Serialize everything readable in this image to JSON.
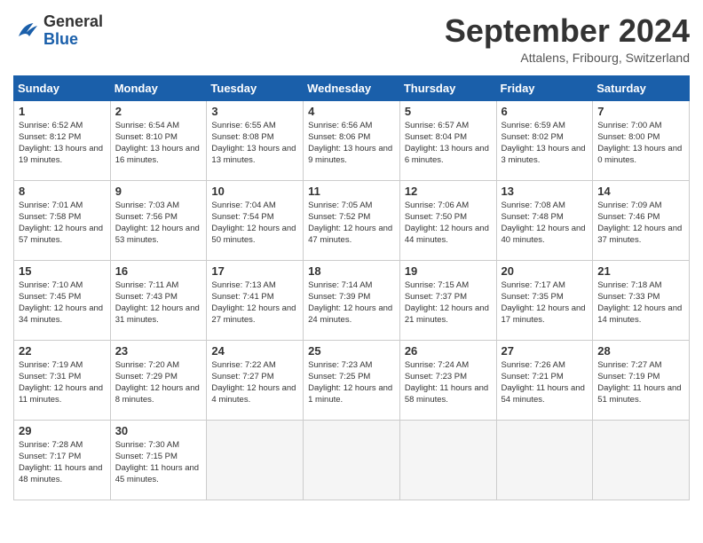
{
  "header": {
    "logo_general": "General",
    "logo_blue": "Blue",
    "month_title": "September 2024",
    "location": "Attalens, Fribourg, Switzerland"
  },
  "days_of_week": [
    "Sunday",
    "Monday",
    "Tuesday",
    "Wednesday",
    "Thursday",
    "Friday",
    "Saturday"
  ],
  "weeks": [
    [
      {
        "day": "1",
        "sunrise": "6:52 AM",
        "sunset": "8:12 PM",
        "daylight": "13 hours and 19 minutes."
      },
      {
        "day": "2",
        "sunrise": "6:54 AM",
        "sunset": "8:10 PM",
        "daylight": "13 hours and 16 minutes."
      },
      {
        "day": "3",
        "sunrise": "6:55 AM",
        "sunset": "8:08 PM",
        "daylight": "13 hours and 13 minutes."
      },
      {
        "day": "4",
        "sunrise": "6:56 AM",
        "sunset": "8:06 PM",
        "daylight": "13 hours and 9 minutes."
      },
      {
        "day": "5",
        "sunrise": "6:57 AM",
        "sunset": "8:04 PM",
        "daylight": "13 hours and 6 minutes."
      },
      {
        "day": "6",
        "sunrise": "6:59 AM",
        "sunset": "8:02 PM",
        "daylight": "13 hours and 3 minutes."
      },
      {
        "day": "7",
        "sunrise": "7:00 AM",
        "sunset": "8:00 PM",
        "daylight": "13 hours and 0 minutes."
      }
    ],
    [
      {
        "day": "8",
        "sunrise": "7:01 AM",
        "sunset": "7:58 PM",
        "daylight": "12 hours and 57 minutes."
      },
      {
        "day": "9",
        "sunrise": "7:03 AM",
        "sunset": "7:56 PM",
        "daylight": "12 hours and 53 minutes."
      },
      {
        "day": "10",
        "sunrise": "7:04 AM",
        "sunset": "7:54 PM",
        "daylight": "12 hours and 50 minutes."
      },
      {
        "day": "11",
        "sunrise": "7:05 AM",
        "sunset": "7:52 PM",
        "daylight": "12 hours and 47 minutes."
      },
      {
        "day": "12",
        "sunrise": "7:06 AM",
        "sunset": "7:50 PM",
        "daylight": "12 hours and 44 minutes."
      },
      {
        "day": "13",
        "sunrise": "7:08 AM",
        "sunset": "7:48 PM",
        "daylight": "12 hours and 40 minutes."
      },
      {
        "day": "14",
        "sunrise": "7:09 AM",
        "sunset": "7:46 PM",
        "daylight": "12 hours and 37 minutes."
      }
    ],
    [
      {
        "day": "15",
        "sunrise": "7:10 AM",
        "sunset": "7:45 PM",
        "daylight": "12 hours and 34 minutes."
      },
      {
        "day": "16",
        "sunrise": "7:11 AM",
        "sunset": "7:43 PM",
        "daylight": "12 hours and 31 minutes."
      },
      {
        "day": "17",
        "sunrise": "7:13 AM",
        "sunset": "7:41 PM",
        "daylight": "12 hours and 27 minutes."
      },
      {
        "day": "18",
        "sunrise": "7:14 AM",
        "sunset": "7:39 PM",
        "daylight": "12 hours and 24 minutes."
      },
      {
        "day": "19",
        "sunrise": "7:15 AM",
        "sunset": "7:37 PM",
        "daylight": "12 hours and 21 minutes."
      },
      {
        "day": "20",
        "sunrise": "7:17 AM",
        "sunset": "7:35 PM",
        "daylight": "12 hours and 17 minutes."
      },
      {
        "day": "21",
        "sunrise": "7:18 AM",
        "sunset": "7:33 PM",
        "daylight": "12 hours and 14 minutes."
      }
    ],
    [
      {
        "day": "22",
        "sunrise": "7:19 AM",
        "sunset": "7:31 PM",
        "daylight": "12 hours and 11 minutes."
      },
      {
        "day": "23",
        "sunrise": "7:20 AM",
        "sunset": "7:29 PM",
        "daylight": "12 hours and 8 minutes."
      },
      {
        "day": "24",
        "sunrise": "7:22 AM",
        "sunset": "7:27 PM",
        "daylight": "12 hours and 4 minutes."
      },
      {
        "day": "25",
        "sunrise": "7:23 AM",
        "sunset": "7:25 PM",
        "daylight": "12 hours and 1 minute."
      },
      {
        "day": "26",
        "sunrise": "7:24 AM",
        "sunset": "7:23 PM",
        "daylight": "11 hours and 58 minutes."
      },
      {
        "day": "27",
        "sunrise": "7:26 AM",
        "sunset": "7:21 PM",
        "daylight": "11 hours and 54 minutes."
      },
      {
        "day": "28",
        "sunrise": "7:27 AM",
        "sunset": "7:19 PM",
        "daylight": "11 hours and 51 minutes."
      }
    ],
    [
      {
        "day": "29",
        "sunrise": "7:28 AM",
        "sunset": "7:17 PM",
        "daylight": "11 hours and 48 minutes."
      },
      {
        "day": "30",
        "sunrise": "7:30 AM",
        "sunset": "7:15 PM",
        "daylight": "11 hours and 45 minutes."
      },
      null,
      null,
      null,
      null,
      null
    ]
  ]
}
